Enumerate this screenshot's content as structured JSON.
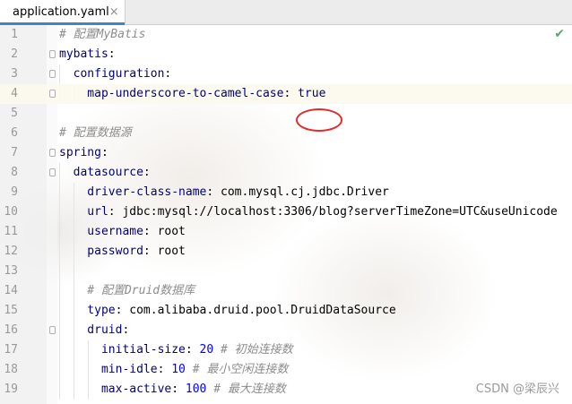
{
  "tab": {
    "filename": "application.yaml",
    "icon": "spring-leaf-icon",
    "close_glyph": "×"
  },
  "status": {
    "inspection_icon": "check-icon",
    "inspection_glyph": "✔"
  },
  "watermark": "CSDN @梁辰兴",
  "colors": {
    "key": "#000080",
    "comment": "#8c8c8c",
    "number": "#0000ff",
    "highlight_circle": "#e32b2b",
    "tab_accent": "#4083c9"
  },
  "lines": [
    {
      "num": "1",
      "tokens": [
        {
          "t": "# 配置MyBatis",
          "c": "comment"
        }
      ]
    },
    {
      "num": "2",
      "tokens": [
        {
          "t": "mybatis",
          "c": "key"
        },
        {
          "t": ":",
          "c": "val"
        }
      ]
    },
    {
      "num": "3",
      "tokens": [
        {
          "t": "  configuration",
          "c": "key"
        },
        {
          "t": ":",
          "c": "val"
        }
      ]
    },
    {
      "num": "4",
      "tokens": [
        {
          "t": "    map-underscore-to-camel-case",
          "c": "key"
        },
        {
          "t": ": ",
          "c": "val"
        },
        {
          "t": "true",
          "c": "bool"
        }
      ]
    },
    {
      "num": "5",
      "tokens": []
    },
    {
      "num": "6",
      "tokens": [
        {
          "t": "# 配置数据源",
          "c": "comment"
        }
      ]
    },
    {
      "num": "7",
      "tokens": [
        {
          "t": "spring",
          "c": "key"
        },
        {
          "t": ":",
          "c": "val"
        }
      ]
    },
    {
      "num": "8",
      "tokens": [
        {
          "t": "  datasource",
          "c": "key"
        },
        {
          "t": ":",
          "c": "val"
        }
      ]
    },
    {
      "num": "9",
      "tokens": [
        {
          "t": "    driver-class-name",
          "c": "key"
        },
        {
          "t": ": com.mysql.cj.jdbc.Driver",
          "c": "val"
        }
      ]
    },
    {
      "num": "10",
      "tokens": [
        {
          "t": "    url",
          "c": "key"
        },
        {
          "t": ": jdbc:mysql://localhost:3306/blog?serverTimeZone=UTC&useUnicode",
          "c": "val"
        }
      ]
    },
    {
      "num": "11",
      "tokens": [
        {
          "t": "    username",
          "c": "key"
        },
        {
          "t": ": root",
          "c": "val"
        }
      ]
    },
    {
      "num": "12",
      "tokens": [
        {
          "t": "    password",
          "c": "key"
        },
        {
          "t": ": root",
          "c": "val"
        }
      ]
    },
    {
      "num": "13",
      "tokens": []
    },
    {
      "num": "14",
      "tokens": [
        {
          "t": "    # 配置Druid数据库",
          "c": "comment"
        }
      ]
    },
    {
      "num": "15",
      "tokens": [
        {
          "t": "    type",
          "c": "key"
        },
        {
          "t": ": com.alibaba.druid.pool.DruidDataSource",
          "c": "val"
        }
      ]
    },
    {
      "num": "16",
      "tokens": [
        {
          "t": "    druid",
          "c": "key"
        },
        {
          "t": ":",
          "c": "val"
        }
      ]
    },
    {
      "num": "17",
      "tokens": [
        {
          "t": "      initial-size",
          "c": "key"
        },
        {
          "t": ": ",
          "c": "val"
        },
        {
          "t": "20",
          "c": "num"
        },
        {
          "t": " # 初始连接数",
          "c": "comment"
        }
      ]
    },
    {
      "num": "18",
      "tokens": [
        {
          "t": "      min-idle",
          "c": "key"
        },
        {
          "t": ": ",
          "c": "val"
        },
        {
          "t": "10",
          "c": "num"
        },
        {
          "t": " # 最小空闲连接数",
          "c": "comment"
        }
      ]
    },
    {
      "num": "19",
      "tokens": [
        {
          "t": "      max-active",
          "c": "key"
        },
        {
          "t": ": ",
          "c": "val"
        },
        {
          "t": "100",
          "c": "num"
        },
        {
          "t": " # 最大连接数",
          "c": "comment"
        }
      ]
    }
  ]
}
